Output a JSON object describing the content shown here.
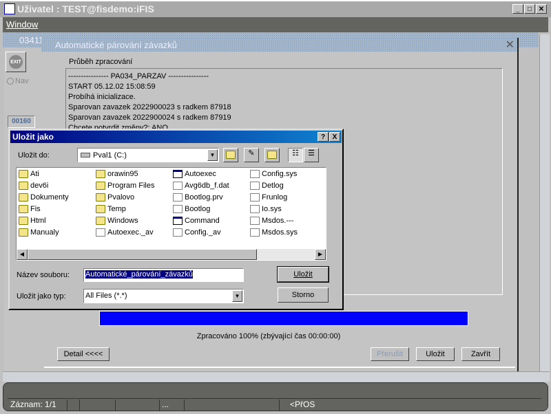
{
  "app": {
    "title": "Uživatel : TEST@fisdemo:iFIS",
    "menu": [
      "Window"
    ]
  },
  "bg_window": {
    "title": "03411",
    "exit_label": "EXIT",
    "nav_label": "Nav",
    "code": "00160"
  },
  "progress_window": {
    "title": "Automatické párování závazků",
    "section_label": "Průběh zpracování",
    "log": [
      "---------------- PA034_PARZAV ----------------",
      "START 05.12.02 15:08:59",
      "Probíhá inicializace.",
      "Sparovan zavazek 2022900023 s radkem 87918",
      "Sparovan zavazek 2022900024 s radkem 87919",
      "Chcete potvrdit změny?: ANO"
    ],
    "progress_percent": 100,
    "progress_text": "Zpracováno 100% (zbývající čas 00:00:00)",
    "buttons": {
      "detail": "Detail <<<<",
      "interrupt": "Přerušit",
      "save": "Uložit",
      "close": "Zavřít"
    }
  },
  "save_dialog": {
    "title": "Uložit jako",
    "help": "?",
    "close": "X",
    "save_in_label": "Uložit do:",
    "save_in_value": "Pval1 (C:)",
    "files": [
      {
        "name": "Ati",
        "type": "folder"
      },
      {
        "name": "dev6i",
        "type": "folder"
      },
      {
        "name": "Dokumenty",
        "type": "folder"
      },
      {
        "name": "Fis",
        "type": "folder"
      },
      {
        "name": "Html",
        "type": "folder"
      },
      {
        "name": "Manualy",
        "type": "folder"
      },
      {
        "name": "orawin95",
        "type": "folder"
      },
      {
        "name": "Program Files",
        "type": "folder"
      },
      {
        "name": "Pvalovo",
        "type": "folder"
      },
      {
        "name": "Temp",
        "type": "folder"
      },
      {
        "name": "Windows",
        "type": "folder"
      },
      {
        "name": "Autoexec._av",
        "type": "doc"
      },
      {
        "name": "Autoexec",
        "type": "exe"
      },
      {
        "name": "Avg6db_f.dat",
        "type": "doc"
      },
      {
        "name": "Bootlog.prv",
        "type": "doc"
      },
      {
        "name": "Bootlog",
        "type": "doc"
      },
      {
        "name": "Command",
        "type": "exe"
      },
      {
        "name": "Config._av",
        "type": "doc"
      },
      {
        "name": "Config.sys",
        "type": "doc"
      },
      {
        "name": "Detlog",
        "type": "doc"
      },
      {
        "name": "Frunlog",
        "type": "doc"
      },
      {
        "name": "Io.sys",
        "type": "doc"
      },
      {
        "name": "Msdos.---",
        "type": "doc"
      },
      {
        "name": "Msdos.sys",
        "type": "doc"
      }
    ],
    "filename_label": "Název souboru:",
    "filename_value": "Automatické_párování_závazků",
    "filetype_label": "Uložit jako typ:",
    "filetype_value": "All Files (*.*)",
    "save_button": "Uložit",
    "cancel_button": "Storno"
  },
  "status": {
    "record": "Záznam: 1/1",
    "ellipsis": "...",
    "mode": "<PřOS"
  }
}
